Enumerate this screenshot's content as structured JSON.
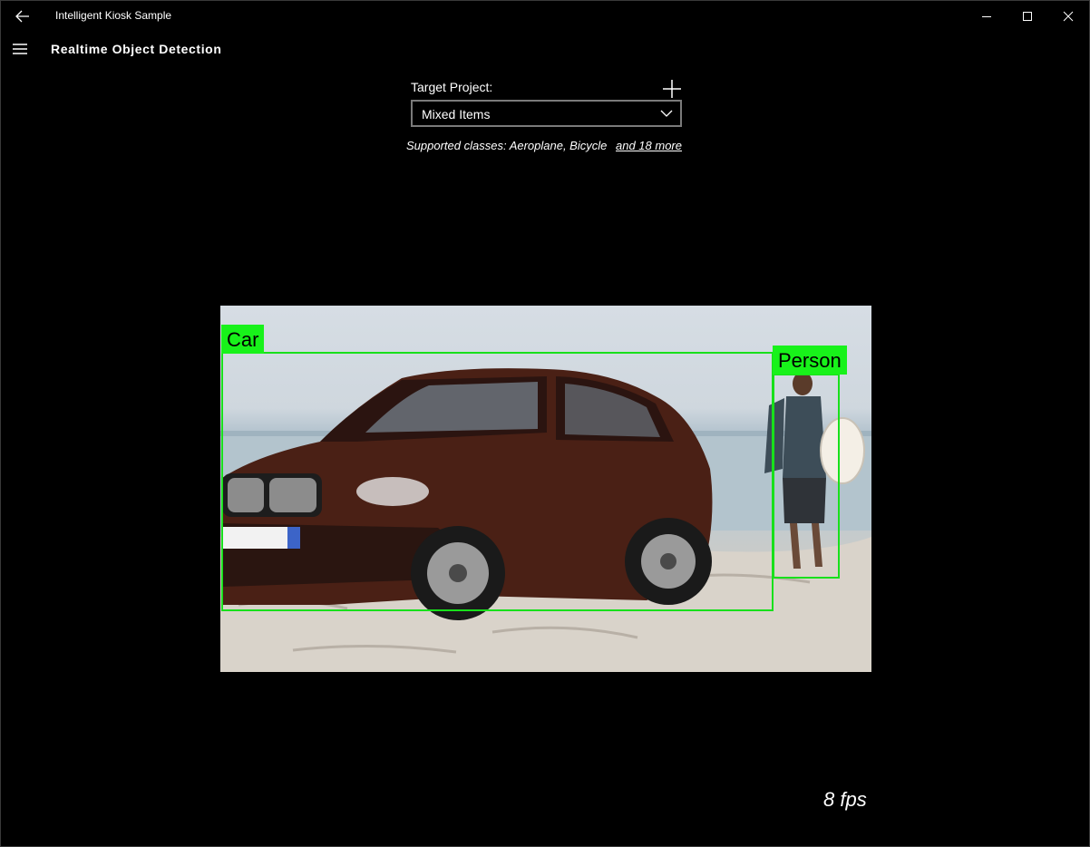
{
  "window": {
    "title": "Intelligent Kiosk Sample",
    "back_icon": "back-arrow-icon",
    "controls": [
      "minimize-icon",
      "maximize-icon",
      "close-icon"
    ]
  },
  "header": {
    "menu_icon": "hamburger-icon",
    "page_title": "Realtime Object Detection"
  },
  "target_project": {
    "label": "Target Project:",
    "add_icon": "plus-icon",
    "selected": "Mixed Items",
    "supported_prefix": "Supported classes: Aeroplane, Bicycle",
    "more_link": "and 18 more"
  },
  "detections": [
    {
      "label": "Car"
    },
    {
      "label": "Person"
    }
  ],
  "colors": {
    "detection": "#18f21a",
    "background": "#000000"
  },
  "status": {
    "fps": "8 fps"
  }
}
